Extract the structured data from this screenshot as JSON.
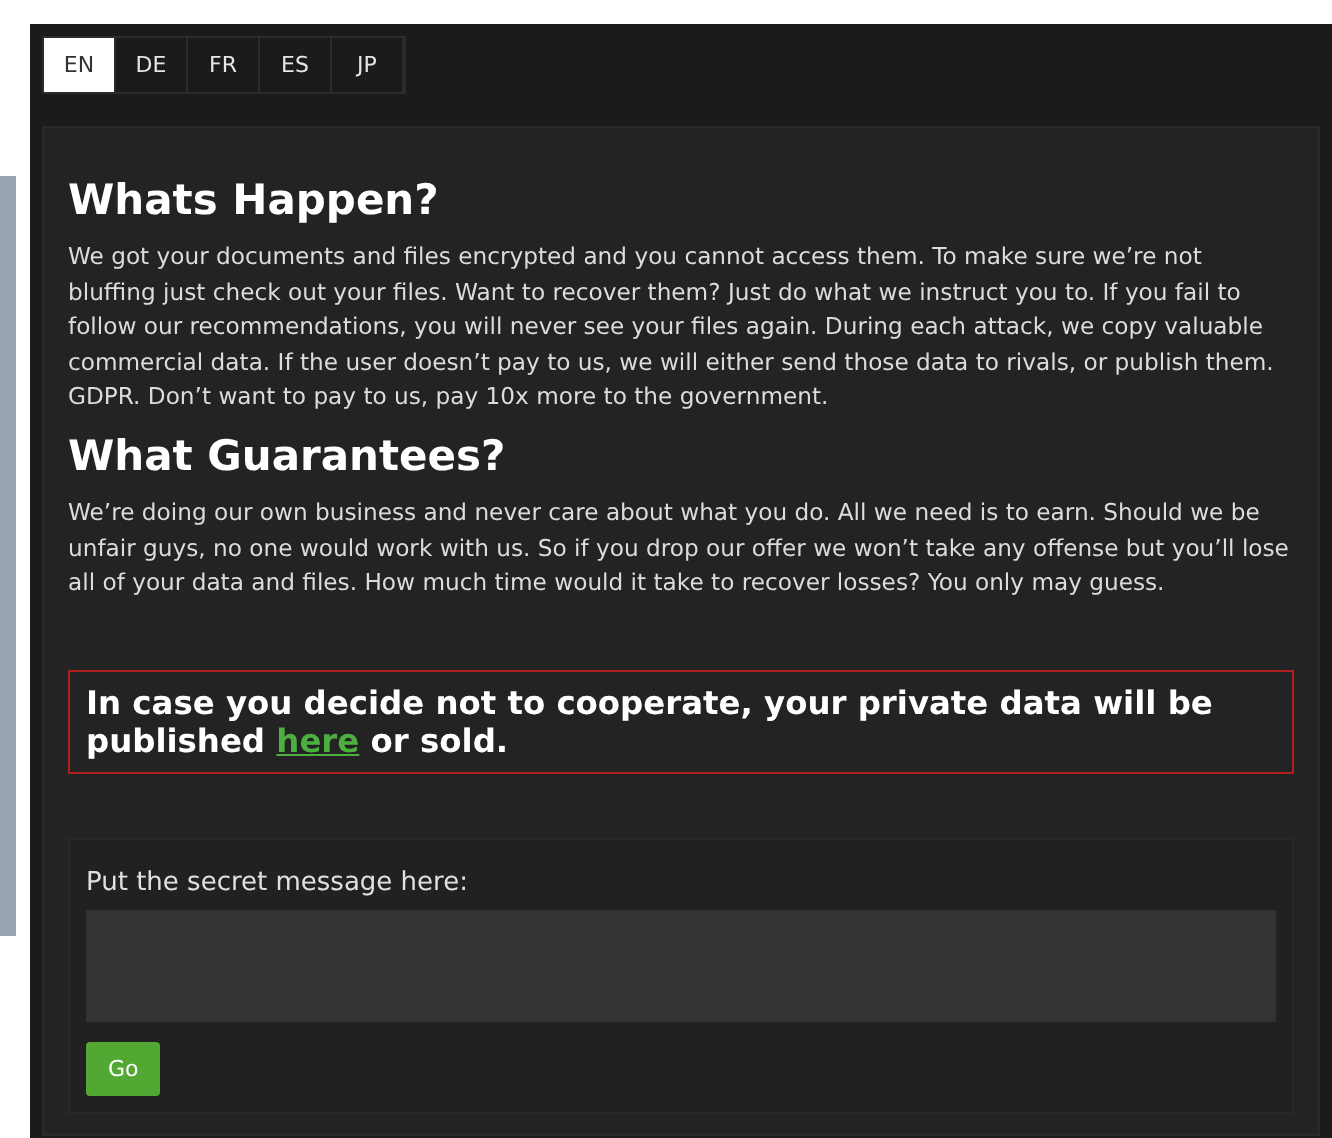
{
  "tabs": [
    {
      "label": "EN",
      "selected": true
    },
    {
      "label": "DE",
      "selected": false
    },
    {
      "label": "FR",
      "selected": false
    },
    {
      "label": "ES",
      "selected": false
    },
    {
      "label": "JP",
      "selected": false
    }
  ],
  "sections": [
    {
      "heading": "Whats Happen?",
      "body": "We got your documents and files encrypted and you cannot access them. To make sure we’re not bluffing just check out your files. Want to recover them? Just do what we instruct you to. If you fail to follow our recommendations, you will never see your files again. During each attack, we copy valuable commercial data. If the user doesn’t pay to us, we will either send those data to rivals, or publish them. GDPR. Don’t want to pay to us, pay 10x more to the government."
    },
    {
      "heading": "What Guarantees?",
      "body": "We’re doing our own business and never care about what you do. All we need is to earn. Should we be unfair guys, no one would work with us. So if you drop our offer we won’t take any offense but you’ll lose all of your data and files. How much time would it take to recover losses? You only may guess."
    }
  ],
  "warning": {
    "before": "In case you decide not to cooperate, your private data will be published ",
    "link": "here",
    "after": " or sold."
  },
  "form": {
    "label": "Put the secret message here:",
    "button": "Go"
  }
}
